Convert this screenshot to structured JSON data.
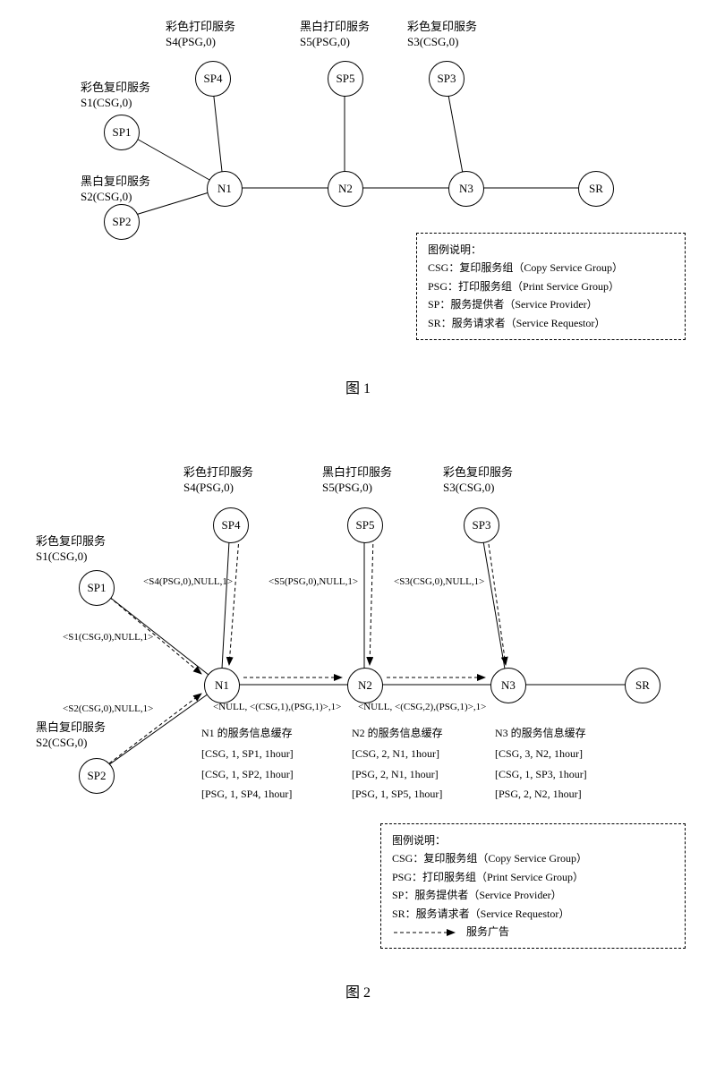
{
  "fig1": {
    "nodes": {
      "SP1": "SP1",
      "SP2": "SP2",
      "SP4": "SP4",
      "SP5": "SP5",
      "SP3": "SP3",
      "N1": "N1",
      "N2": "N2",
      "N3": "N3",
      "SR": "SR"
    },
    "labels": {
      "sp4_top1": "彩色打印服务",
      "sp4_top2": "S4(PSG,0)",
      "sp5_top1": "黑白打印服务",
      "sp5_top2": "S5(PSG,0)",
      "sp3_top1": "彩色复印服务",
      "sp3_top2": "S3(CSG,0)",
      "sp1_top1": "彩色复印服务",
      "sp1_top2": "S1(CSG,0)",
      "sp2_top1": "黑白复印服务",
      "sp2_top2": "S2(CSG,0)"
    },
    "legend": {
      "title": "图例说明：",
      "l1": "CSG：复印服务组（Copy Service Group）",
      "l2": "PSG：打印服务组（Print Service Group）",
      "l3": "SP：服务提供者（Service Provider）",
      "l4": "SR：服务请求者（Service Requestor）"
    },
    "caption": "图 1"
  },
  "fig2": {
    "nodes": {
      "SP1": "SP1",
      "SP2": "SP2",
      "SP4": "SP4",
      "SP5": "SP5",
      "SP3": "SP3",
      "N1": "N1",
      "N2": "N2",
      "N3": "N3",
      "SR": "SR"
    },
    "labels": {
      "sp4_top1": "彩色打印服务",
      "sp4_top2": "S4(PSG,0)",
      "sp5_top1": "黑白打印服务",
      "sp5_top2": "S5(PSG,0)",
      "sp3_top1": "彩色复印服务",
      "sp3_top2": "S3(CSG,0)",
      "sp1_top1": "彩色复印服务",
      "sp1_top2": "S1(CSG,0)",
      "sp2_top1": "黑白复印服务",
      "sp2_top2": "S2(CSG,0)",
      "e_sp4": "<S4(PSG,0),NULL,1>",
      "e_sp5": "<S5(PSG,0),NULL,1>",
      "e_sp3": "<S3(CSG,0),NULL,1>",
      "e_sp1": "<S1(CSG,0),NULL,1>",
      "e_sp2": "<S2(CSG,0),NULL,1>",
      "e_n1n2": "<NULL, <(CSG,1),(PSG,1)>,1>",
      "e_n2n3": "<NULL, <(CSG,2),(PSG,1)>,1>",
      "n1_cache_t": "N1 的服务信息缓存",
      "n1_cache_1": "[CSG, 1, SP1, 1hour]",
      "n1_cache_2": "[CSG, 1, SP2, 1hour]",
      "n1_cache_3": "[PSG, 1, SP4, 1hour]",
      "n2_cache_t": "N2 的服务信息缓存",
      "n2_cache_1": "[CSG, 2, N1, 1hour]",
      "n2_cache_2": "[PSG, 2, N1, 1hour]",
      "n2_cache_3": "[PSG, 1, SP5, 1hour]",
      "n3_cache_t": "N3 的服务信息缓存",
      "n3_cache_1": "[CSG, 3, N2, 1hour]",
      "n3_cache_2": "[CSG, 1, SP3, 1hour]",
      "n3_cache_3": "[PSG, 2, N2, 1hour]"
    },
    "legend": {
      "title": "图例说明：",
      "l1": "CSG：复印服务组（Copy Service Group）",
      "l2": "PSG：打印服务组（Print Service Group）",
      "l3": "SP：服务提供者（Service Provider）",
      "l4": "SR：服务请求者（Service Requestor）",
      "l5": "服务广告"
    },
    "caption": "图 2"
  }
}
